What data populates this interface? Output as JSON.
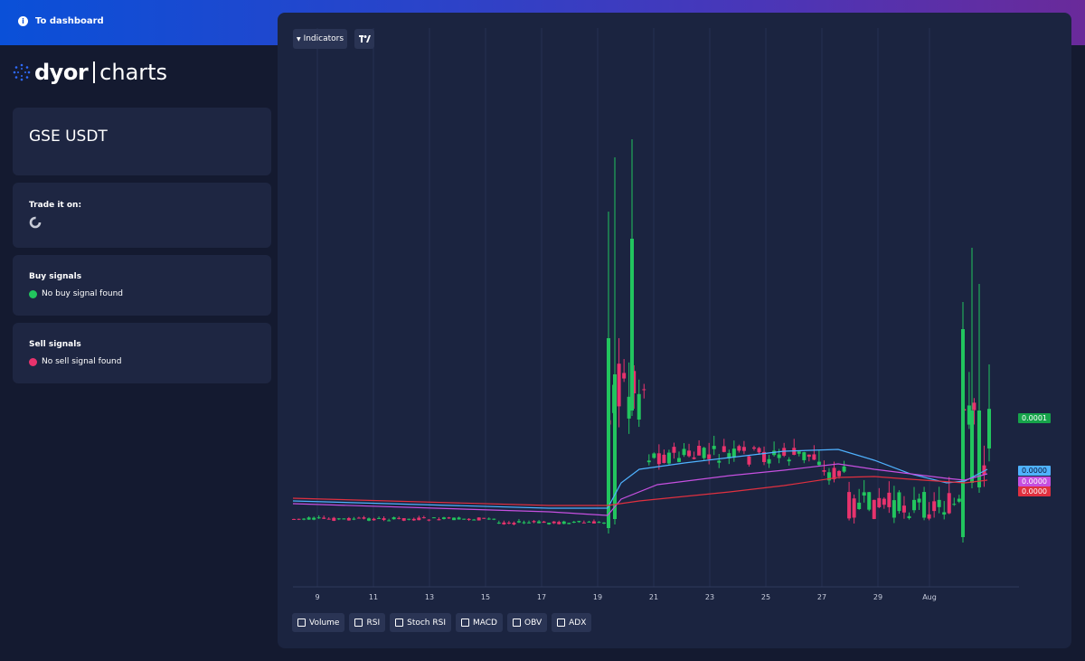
{
  "topbar": {
    "dashboard_label": "To dashboard",
    "info_icon": "info-icon"
  },
  "logo": {
    "dyor": "dyor",
    "charts": "charts"
  },
  "pair": {
    "name": "GSE USDT"
  },
  "trade": {
    "title": "Trade it on:",
    "exchange_icon": "exchange-logo-icon"
  },
  "buy": {
    "title": "Buy signals",
    "status": "No buy signal found",
    "color": "#22c55e"
  },
  "sell": {
    "title": "Sell signals",
    "status": "No sell signal found",
    "color": "#e8336d"
  },
  "toolbar": {
    "indicators_label": "Indicators",
    "tradingview_icon": "tradingview-icon"
  },
  "indicators": [
    "Volume",
    "RSI",
    "Stoch RSI",
    "MACD",
    "OBV",
    "ADX"
  ],
  "price_tags": [
    {
      "label": "0.0001",
      "color": "#16a34a"
    },
    {
      "label": "0.0000",
      "color": "#4fb2ff"
    },
    {
      "label": "0.0000",
      "color": "#c650e0"
    },
    {
      "label": "0.0000",
      "color": "#e0303f"
    }
  ],
  "colors": {
    "up": "#22c55e",
    "down": "#e8336d",
    "ema_fast": "#4fb2ff",
    "ema_mid": "#c650e0",
    "ema_slow": "#e0303f"
  },
  "chart_data": {
    "type": "candlestick",
    "x_ticks": [
      "9",
      "11",
      "13",
      "15",
      "17",
      "19",
      "21",
      "23",
      "25",
      "27",
      "29",
      "Aug"
    ],
    "series": [
      {
        "name": "price",
        "type": "candlestick"
      },
      {
        "type": "line"
      },
      {
        "type": "line"
      },
      {
        "type": "line"
      }
    ],
    "price_labels": [
      "0.0001",
      "0.0000",
      "0.0000",
      "0.0000"
    ]
  }
}
